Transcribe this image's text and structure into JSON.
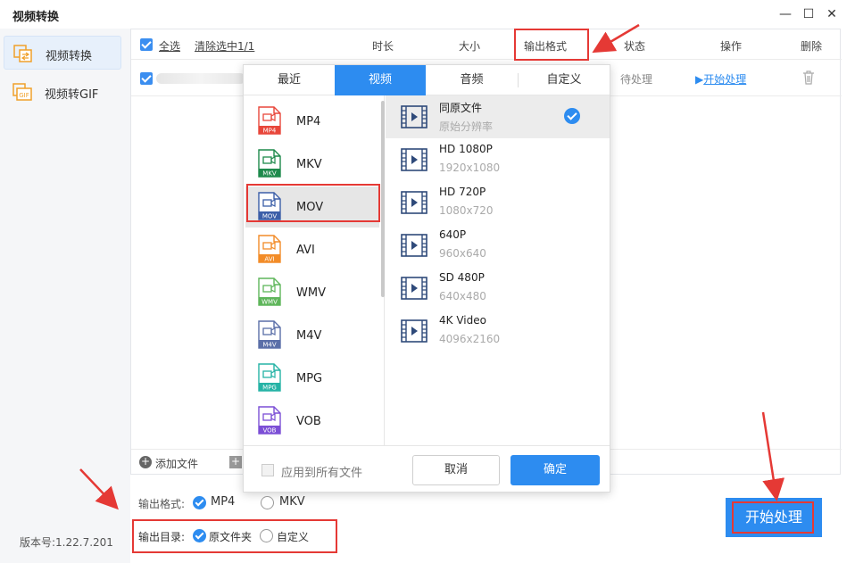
{
  "window": {
    "title": "视频转换",
    "min_icon": "minimize-icon",
    "max_icon": "maximize-icon",
    "close_icon": "close-icon"
  },
  "sidebar": {
    "items": [
      {
        "label": "视频转换",
        "icon": "video-convert-icon",
        "active": true
      },
      {
        "label": "视频转GIF",
        "icon": "gif-icon",
        "active": false
      }
    ],
    "version": "版本号:1.22.7.201"
  },
  "table": {
    "select_all": "全选",
    "clear_selected": "清除选中1/1",
    "columns": {
      "duration": "时长",
      "size": "大小",
      "output_format": "输出格式",
      "status": "状态",
      "action": "操作",
      "delete": "删除"
    },
    "rows": [
      {
        "status": "待处理",
        "action": "开始处理"
      }
    ],
    "add_file": "添加文件"
  },
  "popup": {
    "tabs": [
      "最近",
      "视频",
      "音频",
      "自定义"
    ],
    "active_tab": "视频",
    "formats": [
      {
        "name": "MP4",
        "tag": "MP4",
        "color": "#e8473b"
      },
      {
        "name": "MKV",
        "tag": "MKV",
        "color": "#1e8a4c"
      },
      {
        "name": "MOV",
        "tag": "MOV",
        "color": "#3c5fa8"
      },
      {
        "name": "AVI",
        "tag": "AVI",
        "color": "#f28c28"
      },
      {
        "name": "WMV",
        "tag": "WMV",
        "color": "#5fb65b"
      },
      {
        "name": "M4V",
        "tag": "M4V",
        "color": "#5b6fa8"
      },
      {
        "name": "MPG",
        "tag": "MPG",
        "color": "#26b3a6"
      },
      {
        "name": "VOB",
        "tag": "VOB",
        "color": "#7c4fd6"
      }
    ],
    "selected_format": "MOV",
    "resolutions": [
      {
        "name": "同原文件",
        "sub": "原始分辨率",
        "selected": true
      },
      {
        "name": "HD 1080P",
        "sub": "1920x1080",
        "selected": false
      },
      {
        "name": "HD 720P",
        "sub": "1080x720",
        "selected": false
      },
      {
        "name": "640P",
        "sub": "960x640",
        "selected": false
      },
      {
        "name": "SD 480P",
        "sub": "640x480",
        "selected": false
      },
      {
        "name": "4K Video",
        "sub": "4096x2160",
        "selected": false
      }
    ],
    "apply_all": "应用到所有文件",
    "cancel": "取消",
    "confirm": "确定"
  },
  "bottom": {
    "format_label": "输出格式:",
    "format_options": [
      "MP4",
      "MKV"
    ],
    "format_selected": "MP4",
    "dir_label": "输出目录:",
    "dir_options": [
      "原文件夹",
      "自定义"
    ],
    "dir_selected": "原文件夹",
    "start_button": "开始处理"
  },
  "colors": {
    "accent": "#2d8cf0",
    "highlight": "#e53935"
  }
}
